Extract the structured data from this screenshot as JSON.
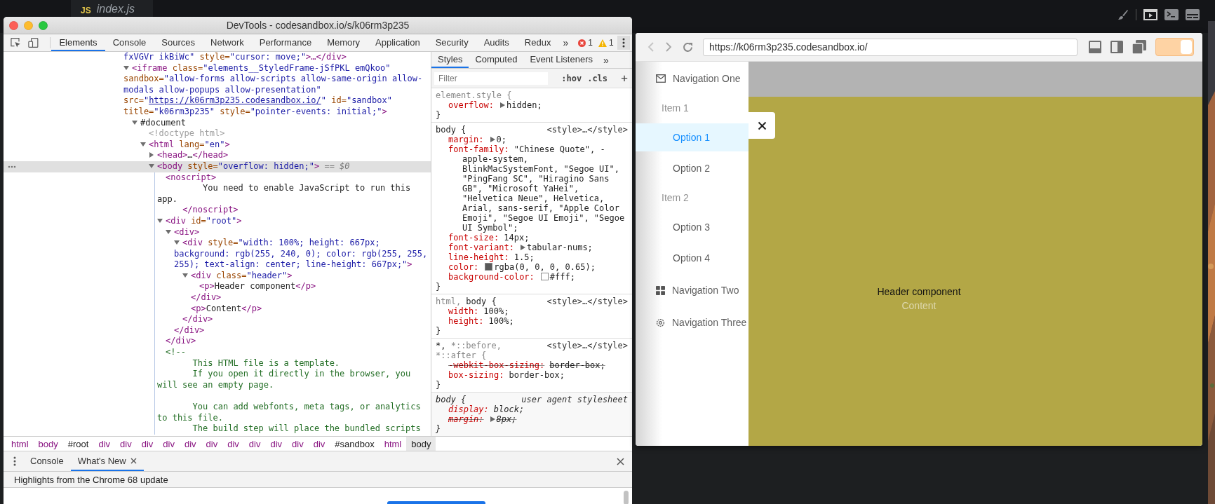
{
  "editor": {
    "file_tab": {
      "badge": "JS",
      "label": "index.js"
    }
  },
  "devtools": {
    "title": "DevTools - codesandbox.io/s/k06rm3p235",
    "tabs": [
      {
        "label": "Elements",
        "selected": true
      },
      {
        "label": "Console",
        "selected": false
      },
      {
        "label": "Sources",
        "selected": false
      },
      {
        "label": "Network",
        "selected": false
      },
      {
        "label": "Performance",
        "selected": false
      },
      {
        "label": "Memory",
        "selected": false
      },
      {
        "label": "Application",
        "selected": false
      },
      {
        "label": "Security",
        "selected": false
      },
      {
        "label": "Audits",
        "selected": false
      },
      {
        "label": "Redux",
        "selected": false
      }
    ],
    "more_tabs": "»",
    "errors": "1",
    "warnings": "1",
    "dom_tree": [
      {
        "kind": "continuation",
        "selected": false,
        "tokens": [
          {
            "kind": "value",
            "text": "fxVGVr ikBiWc\""
          },
          {
            "kind": "attr",
            "text": " style="
          },
          {
            "kind": "value",
            "text": "\"cursor: move;\""
          },
          {
            "kind": "tag",
            "text": ">…</div>"
          }
        ]
      },
      {
        "kind": "element",
        "selected": false,
        "expanded": true,
        "tokens": [
          {
            "kind": "tag",
            "text": "<iframe"
          },
          {
            "kind": "attr",
            "text": " class="
          },
          {
            "kind": "value",
            "text": "\"elements__StyledFrame-jSfPKL emQkoo\""
          },
          {
            "kind": "attr",
            "text": " sandbox="
          },
          {
            "kind": "value",
            "text": "\"allow-forms allow-scripts allow-same-origin allow-modals allow-popups allow-presentation\""
          },
          {
            "kind": "attr",
            "text": " src="
          },
          {
            "kind": "value",
            "text": "\""
          },
          {
            "kind": "link",
            "text": "https://k06rm3p235.codesandbox.io/"
          },
          {
            "kind": "value",
            "text": "\""
          },
          {
            "kind": "attr",
            "text": " id="
          },
          {
            "kind": "value",
            "text": "\"sandbox\""
          },
          {
            "kind": "attr",
            "text": " title="
          },
          {
            "kind": "value",
            "text": "\"k06rm3p235\""
          },
          {
            "kind": "attr",
            "text": " style="
          },
          {
            "kind": "value",
            "text": "\"pointer-events: initial;\""
          },
          {
            "kind": "tag",
            "text": ">"
          }
        ],
        "children": [
          {
            "kind": "element",
            "selected": false,
            "expanded": true,
            "tokens": [
              {
                "kind": "text",
                "text": "#document"
              }
            ],
            "children": [
              {
                "kind": "leaf",
                "selected": false,
                "tokens": [
                  {
                    "kind": "doctype",
                    "text": "<!doctype html>"
                  }
                ]
              },
              {
                "kind": "element",
                "selected": false,
                "expanded": true,
                "tokens": [
                  {
                    "kind": "tag",
                    "text": "<html"
                  },
                  {
                    "kind": "attr",
                    "text": " lang="
                  },
                  {
                    "kind": "value",
                    "text": "\"en\""
                  },
                  {
                    "kind": "tag",
                    "text": ">"
                  }
                ],
                "children": [
                  {
                    "kind": "element",
                    "selected": false,
                    "expanded": false,
                    "tokens": [
                      {
                        "kind": "tag",
                        "text": "<head>"
                      },
                      {
                        "kind": "text",
                        "text": "…"
                      },
                      {
                        "kind": "tag",
                        "text": "</head>"
                      }
                    ]
                  },
                  {
                    "kind": "element",
                    "selected": true,
                    "expanded": true,
                    "tokens": [
                      {
                        "kind": "tag",
                        "text": "<body"
                      },
                      {
                        "kind": "attr",
                        "text": " style="
                      },
                      {
                        "kind": "value",
                        "text": "\"overflow: hidden;\""
                      },
                      {
                        "kind": "tag",
                        "text": ">"
                      },
                      {
                        "kind": "marker",
                        "text": " == $0"
                      }
                    ],
                    "children": [
                      {
                        "kind": "leaf",
                        "selected": false,
                        "tokens": [
                          {
                            "kind": "tag",
                            "text": "<noscript>"
                          },
                          {
                            "kind": "text",
                            "text": "\n         You need to enable JavaScript to run this app.\n     "
                          },
                          {
                            "kind": "tag",
                            "text": "</noscript>"
                          }
                        ]
                      },
                      {
                        "kind": "element",
                        "selected": false,
                        "expanded": true,
                        "tokens": [
                          {
                            "kind": "tag",
                            "text": "<div"
                          },
                          {
                            "kind": "attr",
                            "text": " id="
                          },
                          {
                            "kind": "value",
                            "text": "\"root\""
                          },
                          {
                            "kind": "tag",
                            "text": ">"
                          }
                        ],
                        "close": [
                          {
                            "kind": "tag",
                            "text": "</div>"
                          }
                        ],
                        "children": [
                          {
                            "kind": "element",
                            "selected": false,
                            "expanded": true,
                            "tokens": [
                              {
                                "kind": "tag",
                                "text": "<div>"
                              }
                            ],
                            "close": [
                              {
                                "kind": "tag",
                                "text": "</div>"
                              }
                            ],
                            "children": [
                              {
                                "kind": "element",
                                "selected": false,
                                "expanded": true,
                                "tokens": [
                                  {
                                    "kind": "tag",
                                    "text": "<div"
                                  },
                                  {
                                    "kind": "attr",
                                    "text": " style="
                                  },
                                  {
                                    "kind": "value",
                                    "text": "\"width: 100%; height: 667px; background: rgb(255, 240, 0); color: rgb(255, 255, 255); text-align: center; line-height: 667px;\""
                                  },
                                  {
                                    "kind": "tag",
                                    "text": ">"
                                  }
                                ],
                                "close": [
                                  {
                                    "kind": "tag",
                                    "text": "</div>"
                                  }
                                ],
                                "children": [
                                  {
                                    "kind": "element",
                                    "selected": false,
                                    "expanded": true,
                                    "tokens": [
                                      {
                                        "kind": "tag",
                                        "text": "<div"
                                      },
                                      {
                                        "kind": "attr",
                                        "text": " class="
                                      },
                                      {
                                        "kind": "value",
                                        "text": "\"header\""
                                      },
                                      {
                                        "kind": "tag",
                                        "text": ">"
                                      }
                                    ],
                                    "close": [
                                      {
                                        "kind": "tag",
                                        "text": "</div>"
                                      }
                                    ],
                                    "children": [
                                      {
                                        "kind": "leaf",
                                        "selected": false,
                                        "tokens": [
                                          {
                                            "kind": "tag",
                                            "text": "<p>"
                                          },
                                          {
                                            "kind": "text",
                                            "text": "Header component"
                                          },
                                          {
                                            "kind": "tag",
                                            "text": "</p>"
                                          }
                                        ]
                                      }
                                    ]
                                  },
                                  {
                                    "kind": "leaf",
                                    "selected": false,
                                    "tokens": [
                                      {
                                        "kind": "tag",
                                        "text": "<p>"
                                      },
                                      {
                                        "kind": "text",
                                        "text": "Content"
                                      },
                                      {
                                        "kind": "tag",
                                        "text": "</p>"
                                      }
                                    ]
                                  }
                                ]
                              }
                            ]
                          }
                        ]
                      },
                      {
                        "kind": "leaf",
                        "selected": false,
                        "tokens": [
                          {
                            "kind": "comment",
                            "text": "<!--\n       This HTML file is a template.\n       If you open it directly in the browser, you will see an empty page.\n\n       You can add webfonts, meta tags, or analytics to this file.\n       The build step will place the bundled scripts"
                          }
                        ]
                      }
                    ]
                  }
                ]
              }
            ]
          }
        ]
      }
    ],
    "breadcrumbs": [
      {
        "label": "html",
        "kind": "tag",
        "selected": false
      },
      {
        "label": "body",
        "kind": "tag",
        "selected": false
      },
      {
        "label": "#root",
        "kind": "id",
        "selected": false
      },
      {
        "label": "div",
        "kind": "tag",
        "selected": false
      },
      {
        "label": "div",
        "kind": "tag",
        "selected": false
      },
      {
        "label": "div",
        "kind": "tag",
        "selected": false
      },
      {
        "label": "div",
        "kind": "tag",
        "selected": false
      },
      {
        "label": "div",
        "kind": "tag",
        "selected": false
      },
      {
        "label": "div",
        "kind": "tag",
        "selected": false
      },
      {
        "label": "div",
        "kind": "tag",
        "selected": false
      },
      {
        "label": "div",
        "kind": "tag",
        "selected": false
      },
      {
        "label": "div",
        "kind": "tag",
        "selected": false
      },
      {
        "label": "div",
        "kind": "tag",
        "selected": false
      },
      {
        "label": "div",
        "kind": "tag",
        "selected": false
      },
      {
        "label": "#sandbox",
        "kind": "id",
        "selected": false
      },
      {
        "label": "html",
        "kind": "tag",
        "selected": false
      },
      {
        "label": "body",
        "kind": "tag",
        "selected": true
      }
    ],
    "styles": {
      "tabs": [
        {
          "label": "Styles",
          "selected": true
        },
        {
          "label": "Computed",
          "selected": false
        },
        {
          "label": "Event Listeners",
          "selected": false
        }
      ],
      "more_tabs": "»",
      "filter": {
        "placeholder": "Filter"
      },
      "hov": ":hov",
      "cls": ".cls",
      "add": "+",
      "rules": [
        {
          "kind": "inline",
          "selector": [
            {
              "text": "element.style {",
              "matched": false
            }
          ],
          "close": "}",
          "declarations": [
            {
              "kind": "shorthand",
              "property": "overflow:",
              "value": "hidden;",
              "overridden": false
            }
          ]
        },
        {
          "kind": "author",
          "selector": [
            {
              "text": "body {",
              "matched": true
            }
          ],
          "source": "<style>…</style>",
          "close": "}",
          "declarations": [
            {
              "kind": "shorthand",
              "property": "margin:",
              "value": "0;",
              "overridden": false
            },
            {
              "kind": "plain",
              "property": "font-family:",
              "value": "\"Chinese Quote\", -apple-system, BlinkMacSystemFont, \"Segoe UI\", \"PingFang SC\", \"Hiragino Sans GB\", \"Microsoft YaHei\", \"Helvetica Neue\", Helvetica, Arial, sans-serif, \"Apple Color Emoji\", \"Segoe UI Emoji\", \"Segoe UI Symbol\";",
              "overridden": false
            },
            {
              "kind": "plain",
              "property": "font-size:",
              "value": "14px;",
              "overridden": false
            },
            {
              "kind": "shorthand",
              "property": "font-variant:",
              "value": "tabular-nums;",
              "overridden": false
            },
            {
              "kind": "plain",
              "property": "line-height:",
              "value": "1.5;",
              "overridden": false
            },
            {
              "kind": "color",
              "property": "color:",
              "value": "rgba(0, 0, 0, 0.65);",
              "color": "#595959",
              "overridden": false
            },
            {
              "kind": "color",
              "property": "background-color:",
              "value": "#fff;",
              "color": "#ffffff",
              "overridden": false
            }
          ]
        },
        {
          "kind": "author",
          "selector": [
            {
              "text": "html, ",
              "matched": false
            },
            {
              "text": "body {",
              "matched": true
            }
          ],
          "source": "<style>…</style>",
          "close": "}",
          "declarations": [
            {
              "kind": "plain",
              "property": "width:",
              "value": "100%;",
              "overridden": false
            },
            {
              "kind": "plain",
              "property": "height:",
              "value": "100%;",
              "overridden": false
            }
          ]
        },
        {
          "kind": "author",
          "selector": [
            {
              "text": "*, ",
              "matched": true
            },
            {
              "text": "*::before, *::after {",
              "matched": false
            }
          ],
          "source": "<style>…</style>",
          "close": "}",
          "declarations": [
            {
              "kind": "plain",
              "property": "-webkit-box-sizing:",
              "value": "border-box;",
              "overridden": true
            },
            {
              "kind": "plain",
              "property": "box-sizing:",
              "value": "border-box;",
              "overridden": false
            }
          ]
        },
        {
          "kind": "user-agent",
          "selector": [
            {
              "text": "body {",
              "matched": true
            }
          ],
          "source": "user agent stylesheet",
          "close": "}",
          "declarations": [
            {
              "kind": "plain",
              "property": "display:",
              "value": "block;",
              "overridden": false
            },
            {
              "kind": "shorthand",
              "property": "margin:",
              "value": "8px;",
              "overridden": true
            }
          ]
        }
      ]
    },
    "drawer": {
      "tabs": [
        {
          "label": "Console",
          "selected": false,
          "closable": false
        },
        {
          "label": "What's New",
          "selected": true,
          "closable": true
        }
      ],
      "highlights": "Highlights from the Chrome 68 update"
    }
  },
  "preview": {
    "url": "https://k06rm3p235.codesandbox.io/",
    "toggle": {
      "on": true
    },
    "menu": [
      {
        "kind": "submenu",
        "label": "Navigation One",
        "children": [
          {
            "kind": "group",
            "label": "Item 1",
            "items": [
              {
                "label": "Option 1",
                "selected": true
              },
              {
                "label": "Option 2",
                "selected": false
              }
            ]
          },
          {
            "kind": "group",
            "label": "Item 2",
            "items": [
              {
                "label": "Option 3",
                "selected": false
              },
              {
                "label": "Option 4",
                "selected": false
              }
            ]
          }
        ]
      },
      {
        "kind": "submenu",
        "label": "Navigation Two"
      },
      {
        "kind": "submenu",
        "label": "Navigation Three"
      }
    ],
    "header_text": "Header component",
    "content_text": "Content"
  }
}
